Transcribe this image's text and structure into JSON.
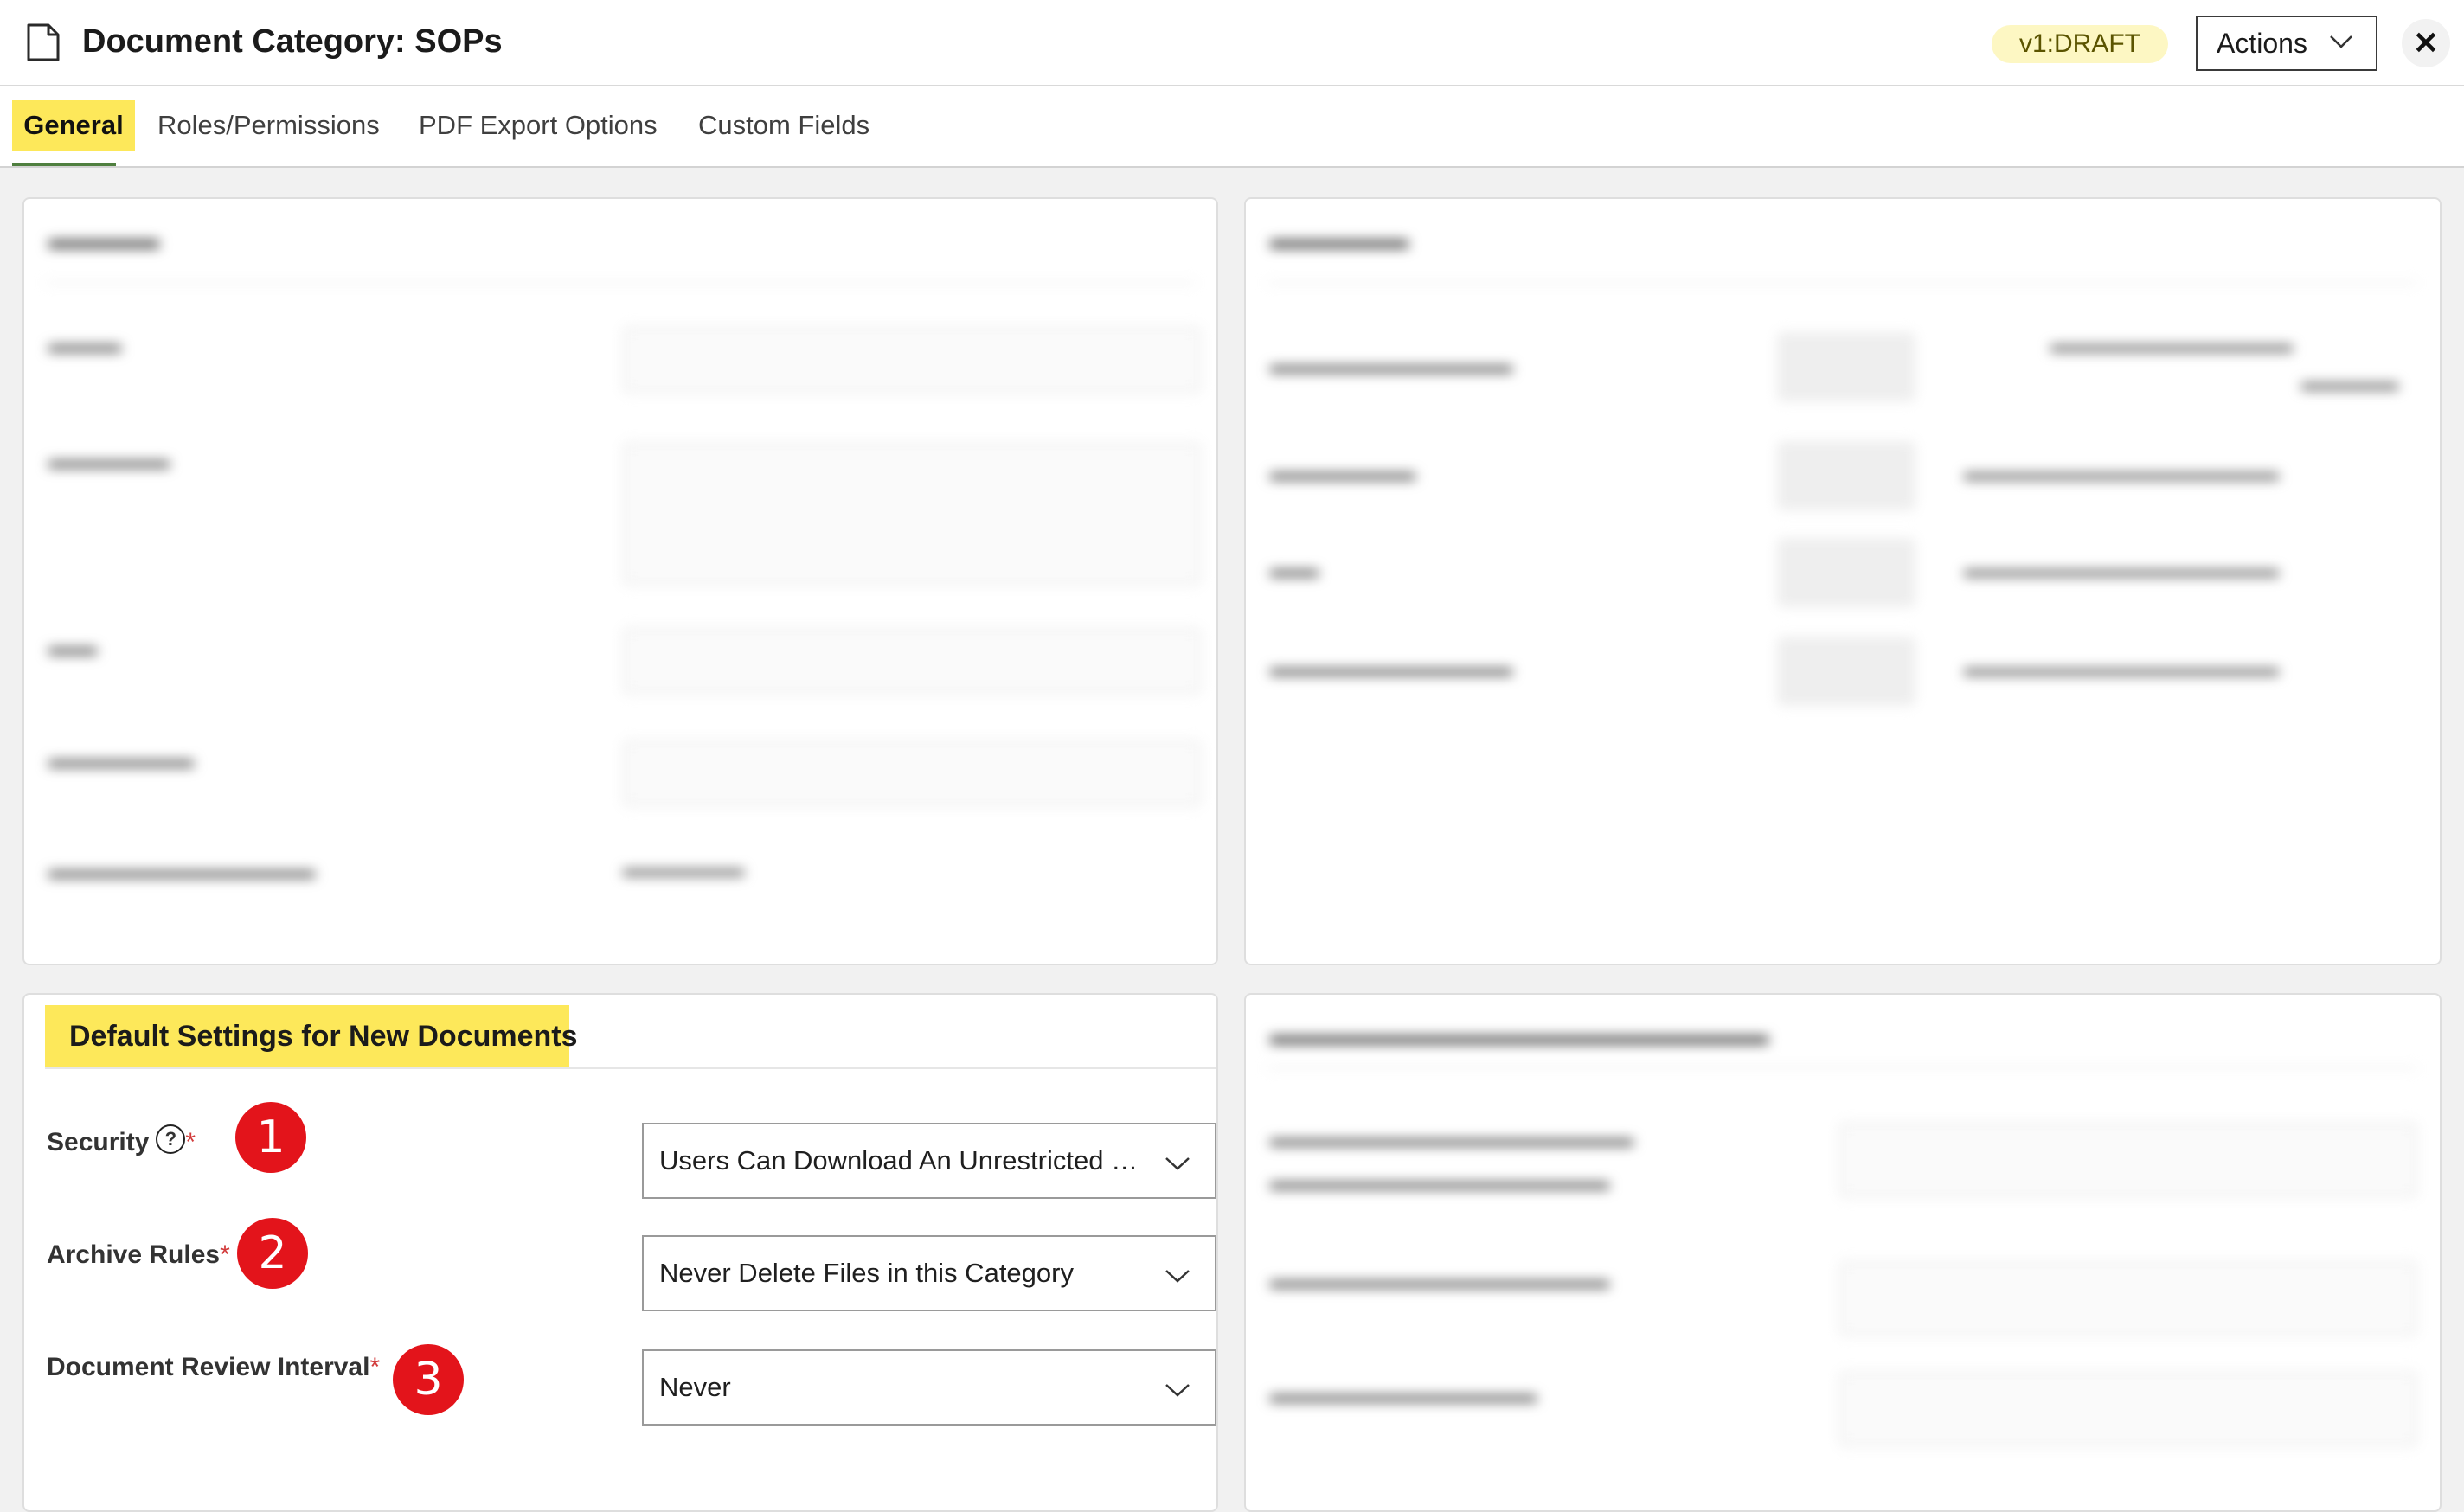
{
  "header": {
    "title": "Document Category: SOPs",
    "version_badge": "v1:DRAFT",
    "actions_label": "Actions",
    "close_glyph": "✕"
  },
  "tabs": [
    {
      "label": "General",
      "active": true
    },
    {
      "label": "Roles/Permissions",
      "active": false
    },
    {
      "label": "PDF Export Options",
      "active": false
    },
    {
      "label": "Custom Fields",
      "active": false
    }
  ],
  "default_settings": {
    "title": "Default Settings for New Documents",
    "fields": [
      {
        "label": "Security",
        "required": "*",
        "help_icon": "?",
        "marker": "1",
        "value": "Users Can Download An Unrestricted P..."
      },
      {
        "label": "Archive Rules",
        "required": "*",
        "marker": "2",
        "value": "Never Delete Files in this Category"
      },
      {
        "label": "Document Review Interval",
        "required": "*",
        "marker": "3",
        "value": "Never"
      }
    ]
  },
  "colors": {
    "highlight": "#fde85a",
    "marker_red": "#e3141b",
    "badge_bg": "#fdf7c3",
    "tab_underline": "#4f7f3f"
  }
}
